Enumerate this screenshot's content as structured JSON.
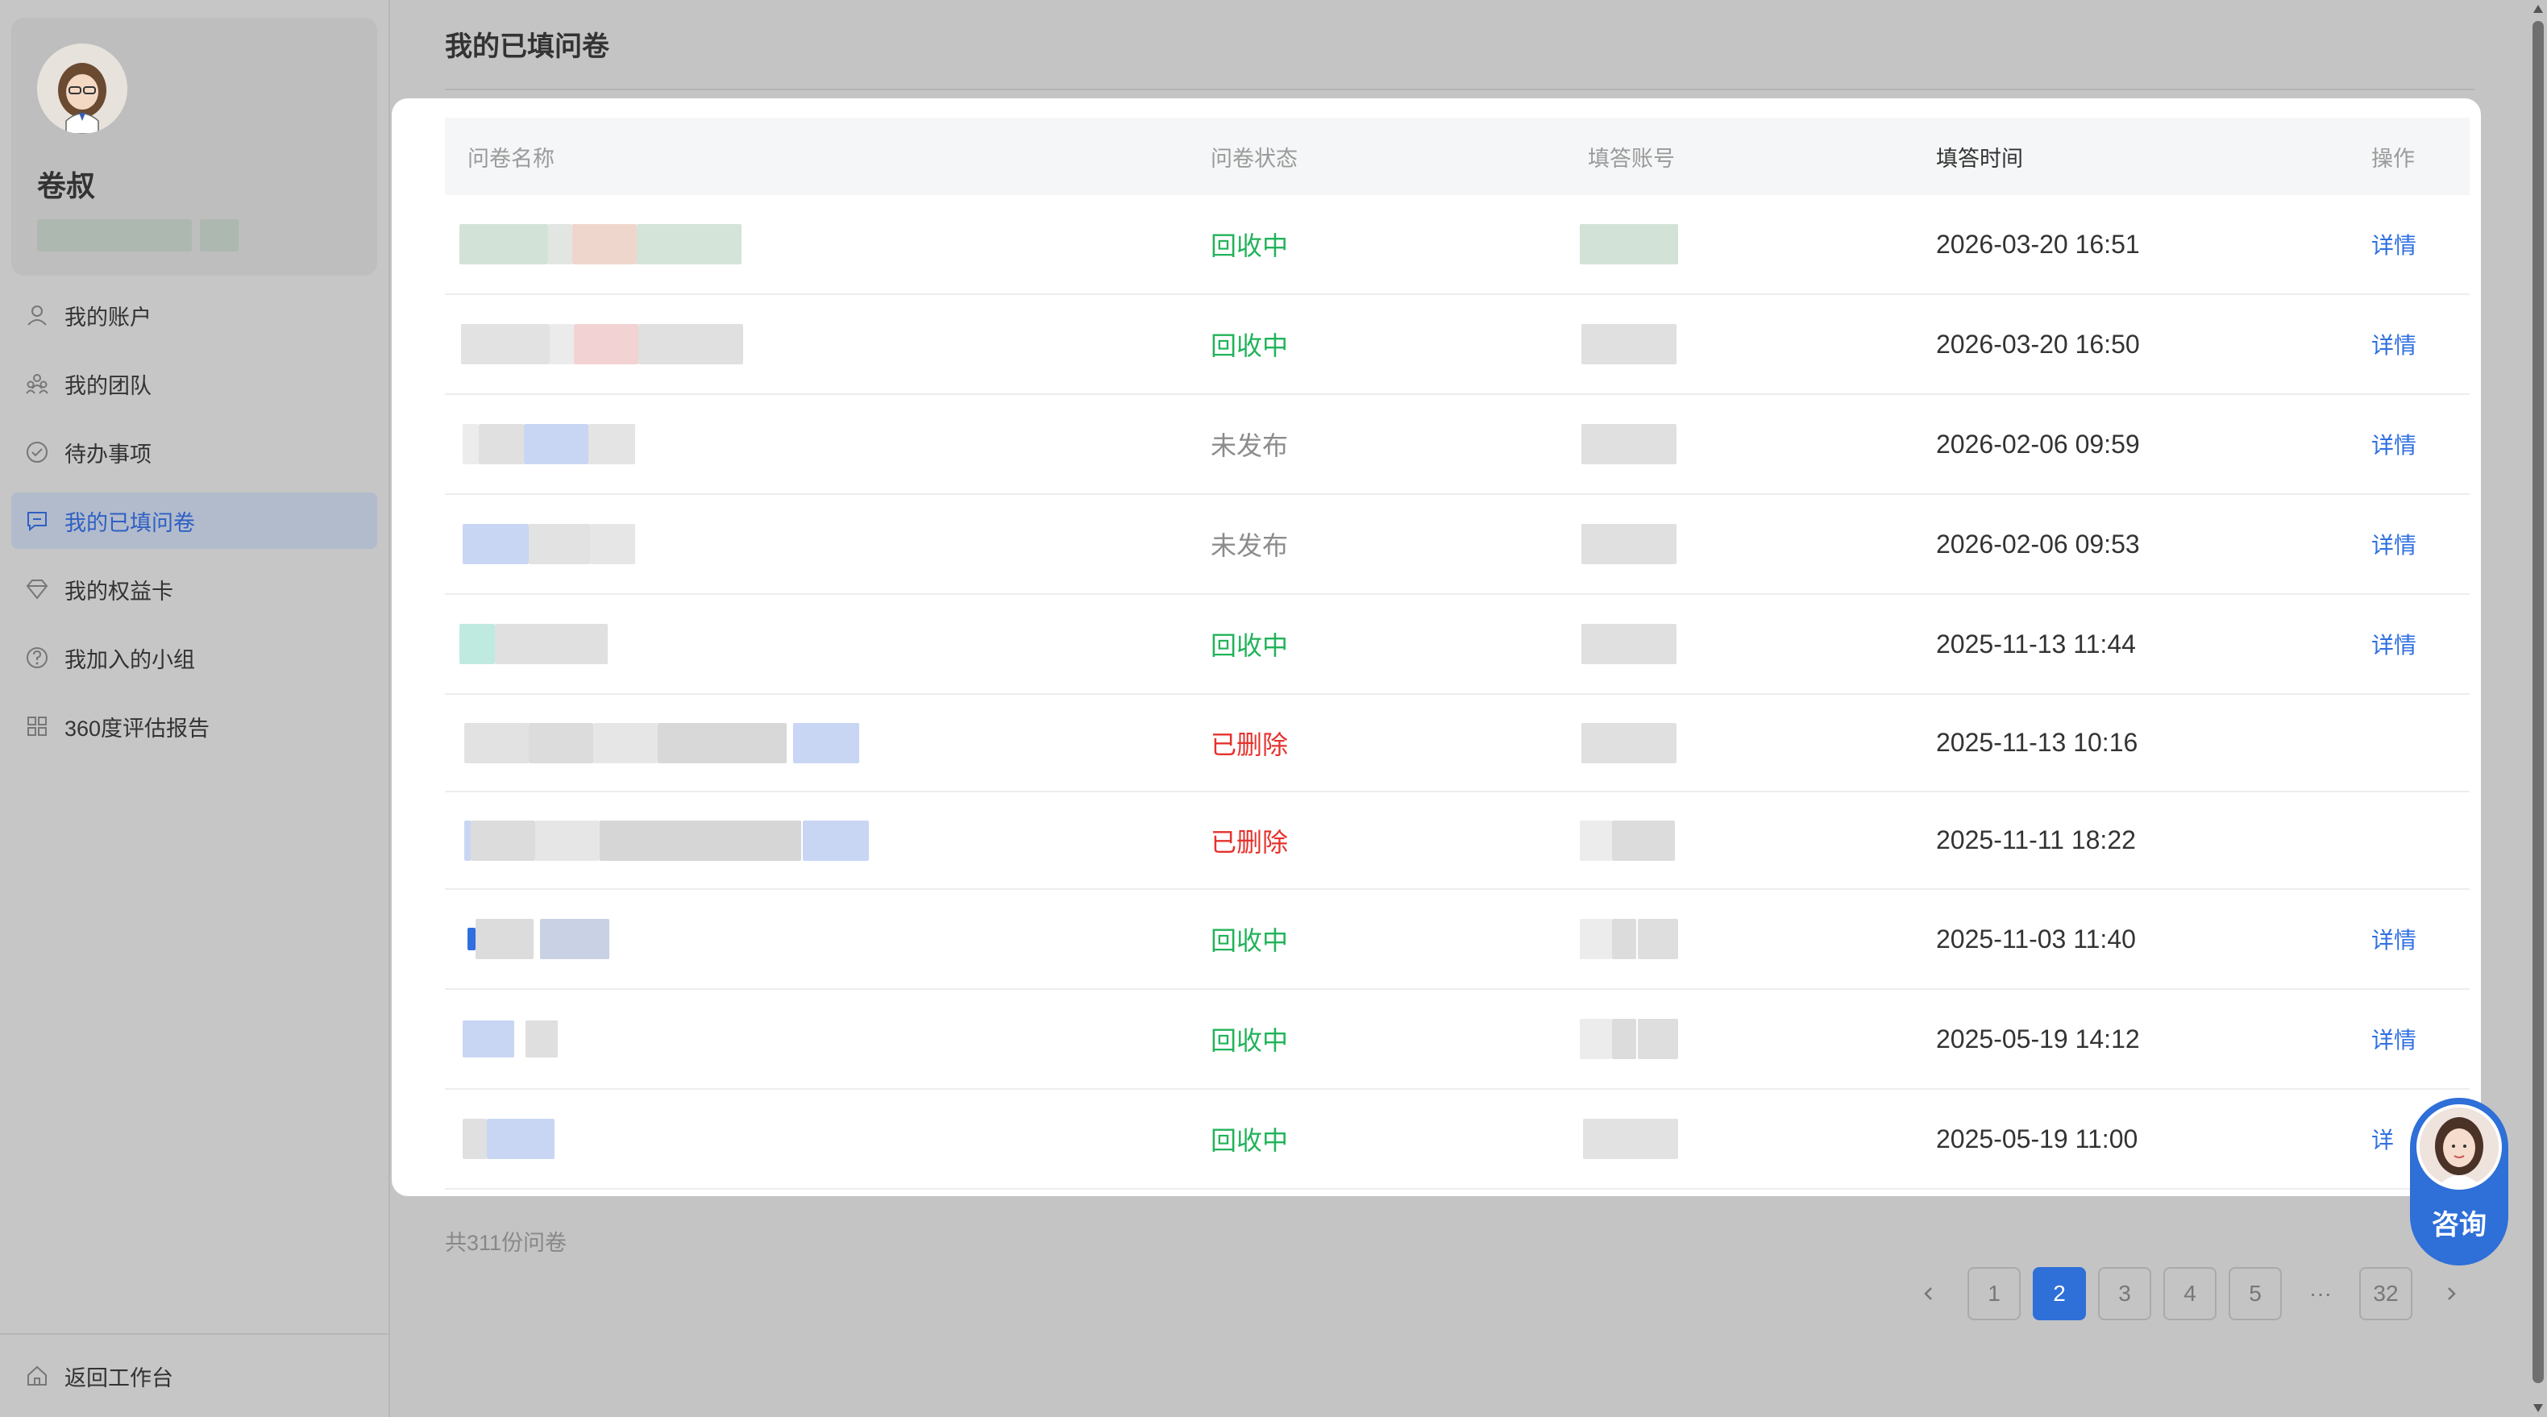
{
  "sidebar": {
    "username": "卷叔",
    "menu": [
      {
        "label": "我的账户",
        "icon": "user-icon",
        "active": false
      },
      {
        "label": "我的团队",
        "icon": "team-icon",
        "active": false
      },
      {
        "label": "待办事项",
        "icon": "check-circle-icon",
        "active": false
      },
      {
        "label": "我的已填问卷",
        "icon": "message-square-icon",
        "active": true
      },
      {
        "label": "我的权益卡",
        "icon": "diamond-icon",
        "active": false
      },
      {
        "label": "我加入的小组",
        "icon": "help-circle-icon",
        "active": false
      },
      {
        "label": "360度评估报告",
        "icon": "grid-icon",
        "active": false
      }
    ],
    "back_label": "返回工作台",
    "back_icon": "home-icon"
  },
  "page": {
    "title": "我的已填问卷"
  },
  "table": {
    "headers": [
      "问卷名称",
      "问卷状态",
      "填答账号",
      "填答时间",
      "操作"
    ],
    "rows": [
      {
        "status": "回收中",
        "status_type": "green",
        "time": "2026-03-20 16:51",
        "action": "详情"
      },
      {
        "status": "回收中",
        "status_type": "green",
        "time": "2026-03-20 16:50",
        "action": "详情"
      },
      {
        "status": "未发布",
        "status_type": "gray",
        "time": "2026-02-06 09:59",
        "action": "详情"
      },
      {
        "status": "未发布",
        "status_type": "gray",
        "time": "2026-02-06 09:53",
        "action": "详情"
      },
      {
        "status": "回收中",
        "status_type": "green",
        "time": "2025-11-13 11:44",
        "action": "详情"
      },
      {
        "status": "已删除",
        "status_type": "red",
        "time": "2025-11-13 10:16",
        "action": ""
      },
      {
        "status": "已删除",
        "status_type": "red",
        "time": "2025-11-11 18:22",
        "action": ""
      },
      {
        "status": "回收中",
        "status_type": "green",
        "time": "2025-11-03 11:40",
        "action": "详情"
      },
      {
        "status": "回收中",
        "status_type": "green",
        "time": "2025-05-19 14:12",
        "action": "详情"
      },
      {
        "status": "回收中",
        "status_type": "green",
        "time": "2025-05-19 11:00",
        "action": "详"
      }
    ]
  },
  "footer": {
    "total": "共311份问卷"
  },
  "pagination": {
    "prev_icon": "chevron-left-icon",
    "pages": [
      "1",
      "2",
      "3",
      "4",
      "5"
    ],
    "current": "2",
    "ellipsis": "···",
    "last": "32",
    "next_icon": "chevron-right-icon"
  },
  "consult": {
    "label": "咨询"
  },
  "colors": {
    "accent": "#2e6fd8",
    "status_green": "#21b35a",
    "status_gray": "#8c8c8c",
    "status_red": "#e5322d",
    "link": "#2f6fe0"
  }
}
